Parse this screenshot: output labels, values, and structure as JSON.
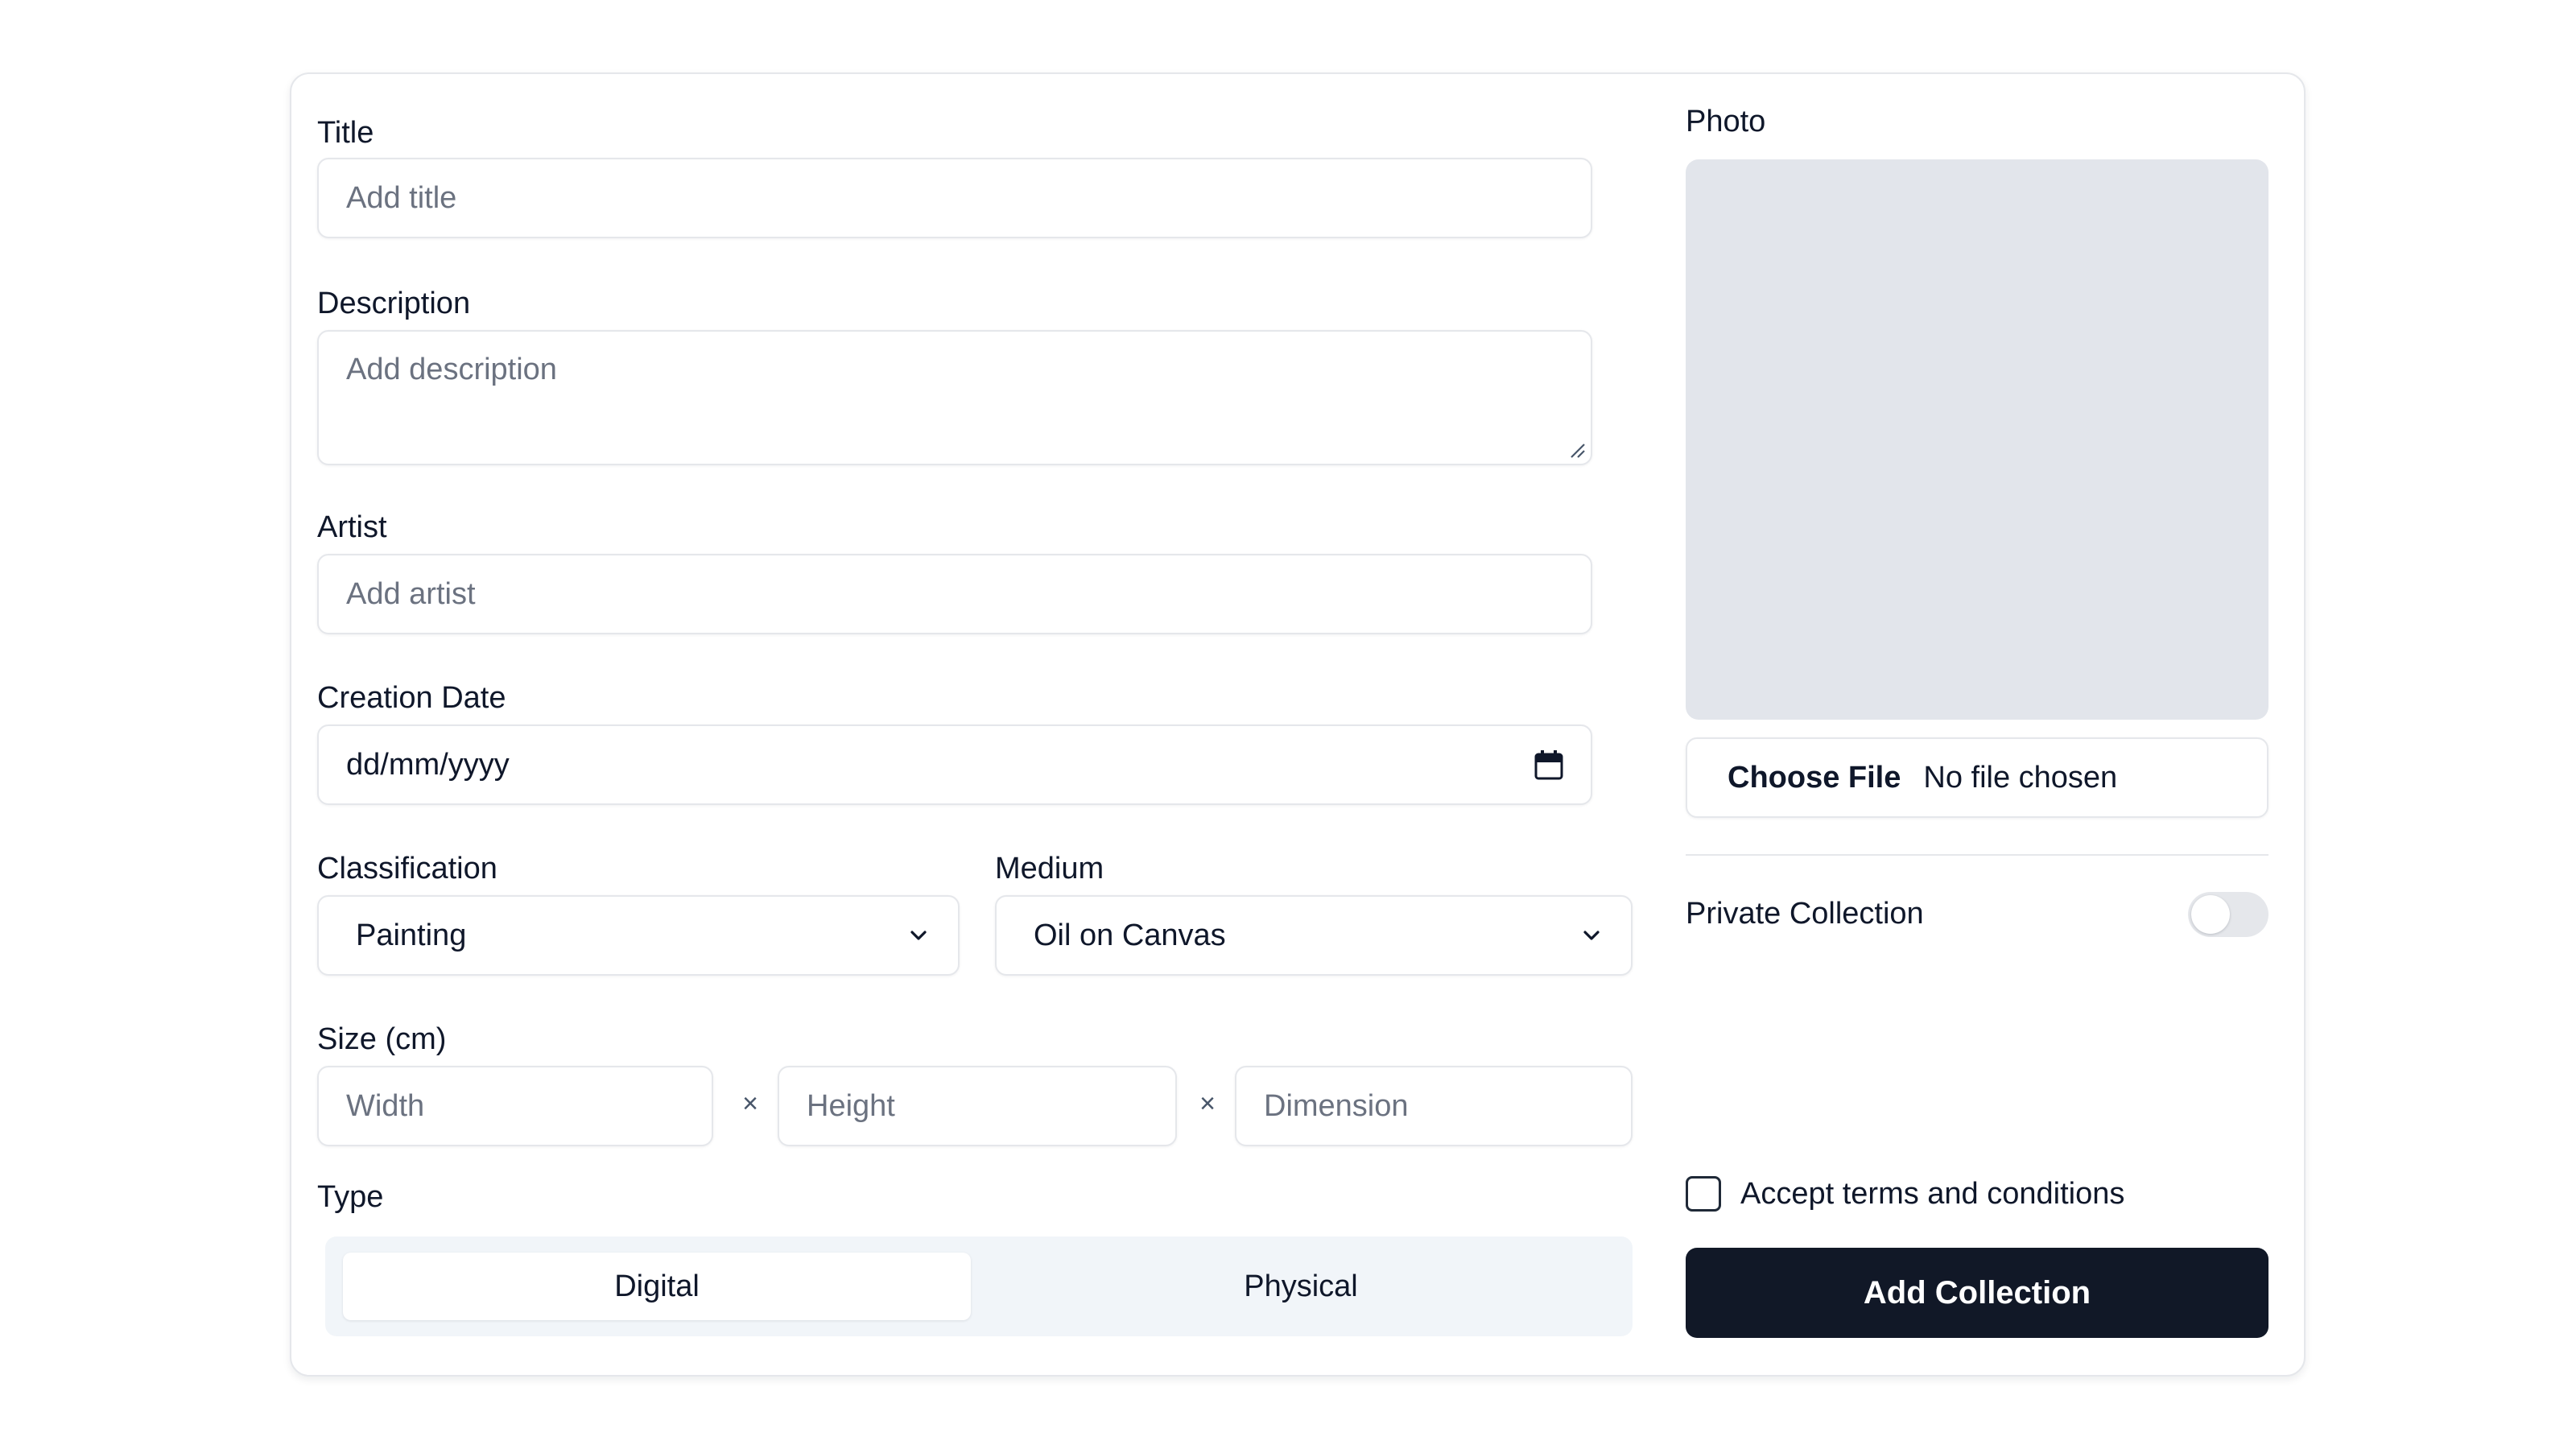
{
  "form": {
    "title": {
      "label": "Title",
      "placeholder": "Add title"
    },
    "description": {
      "label": "Description",
      "placeholder": "Add description"
    },
    "artist": {
      "label": "Artist",
      "placeholder": "Add artist"
    },
    "creation_date": {
      "label": "Creation Date",
      "value": "dd/mm/yyyy"
    },
    "classification": {
      "label": "Classification",
      "selected": "Painting"
    },
    "medium": {
      "label": "Medium",
      "selected": "Oil on Canvas"
    },
    "size": {
      "label": "Size (cm)",
      "width_placeholder": "Width",
      "height_placeholder": "Height",
      "dimension_placeholder": "Dimension",
      "separator": "×"
    },
    "type": {
      "label": "Type",
      "options": [
        {
          "label": "Digital",
          "selected": true
        },
        {
          "label": "Physical",
          "selected": false
        }
      ]
    }
  },
  "photo": {
    "label": "Photo",
    "choose_file_label": "Choose File",
    "file_status": "No file chosen"
  },
  "private_collection": {
    "label": "Private Collection",
    "enabled": false
  },
  "terms": {
    "label": "Accept terms and conditions",
    "checked": false
  },
  "submit": {
    "label": "Add Collection"
  },
  "icons": {
    "date": "calendar-icon",
    "select": "chevron-down-icon",
    "textarea": "resize-handle-icon"
  },
  "colors": {
    "text": "#0f172a",
    "placeholder": "#6b7280",
    "border": "#e5e7eb",
    "photo_placeholder": "#e2e5eb",
    "segmented_bg": "#f1f5f9",
    "primary_button": "#111827"
  }
}
